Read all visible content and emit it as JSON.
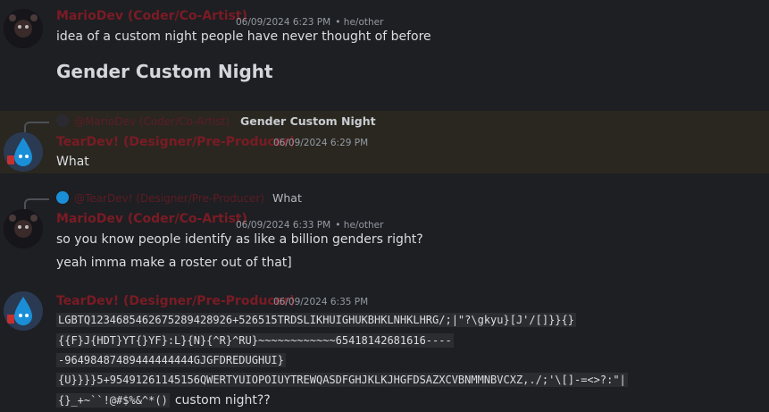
{
  "messages": {
    "m1": {
      "author": "MarioDev (Coder/Co-Artist)",
      "timestamp": "06/09/2024 6:23 PM",
      "pronouns": "• he/other",
      "lines": [
        "idea of a custom night people have never thought of before"
      ],
      "heading": "Gender Custom Night"
    },
    "m2": {
      "reply_author": "@MarioDev (Coder/Co-Artist)",
      "reply_text": "Gender Custom Night",
      "author": "TearDev! (Designer/Pre-Producer)",
      "timestamp": "06/09/2024 6:29 PM",
      "lines": [
        "What"
      ]
    },
    "m3": {
      "reply_author": "@TearDev! (Designer/Pre-Producer)",
      "reply_text": "What",
      "author": "MarioDev (Coder/Co-Artist)",
      "timestamp": "06/09/2024 6:33 PM",
      "pronouns": "• he/other",
      "lines": [
        "so you know people identify as like a billion genders right?",
        "yeah imma make a roster out of that]"
      ]
    },
    "m4": {
      "author": "TearDev! (Designer/Pre-Producer)",
      "timestamp": "06/09/2024 6:35 PM",
      "code_lines": [
        "LGBTQ1234685462675289428926+526515TRDSLIKHUIGHUKBHKLNHKLHRG/;|\"?\\gkyu}[J'/[]}}{}",
        "{{F}J{HDT}YT{}YF}:L}{N}{^R}^RU}~~~~~~~~~~~~65418142681616----",
        "-96498487489444444444GJGFDREDUGHUI}",
        "{U}}}}5+95491261145156QWERTYUIOPOIUYTREWQASDFGHJKLKJHGFDSAZXCVBNMMNBVCXZ,./;'\\[]-=<>?:\"|",
        "{}_+~``!@#$%&^*()"
      ],
      "tail": "custom night??"
    }
  },
  "colors": {
    "background": "#1e1f22",
    "author": "#7a1b25",
    "highlight": "#2a2720"
  }
}
